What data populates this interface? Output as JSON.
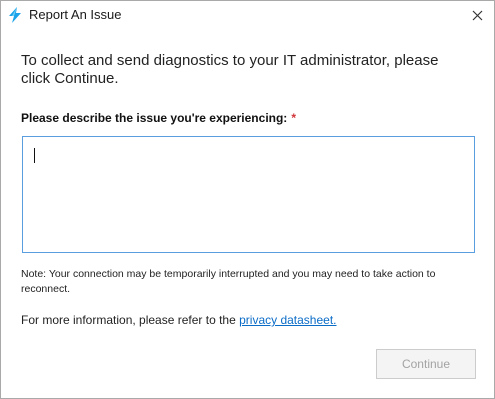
{
  "window": {
    "title": "Report An Issue",
    "app_icon": "app-logo-icon",
    "close_icon": "close-icon"
  },
  "intro_text": "To collect and send diagnostics to your IT administrator, please click Continue.",
  "issue_field": {
    "label": "Please describe the issue you're experiencing:",
    "required_marker": "*",
    "value": ""
  },
  "note": "Note: Your connection may be temporarily interrupted and you may need to take action to reconnect.",
  "more_info": {
    "prefix": "For more information, please refer to the ",
    "link_text": "privacy datasheet."
  },
  "actions": {
    "continue_label": "Continue",
    "continue_enabled": false
  },
  "colors": {
    "accent": "#5a9ee0",
    "link": "#0b6cc7",
    "required": "#d13438",
    "icon_blue": "#1aa3e8"
  }
}
